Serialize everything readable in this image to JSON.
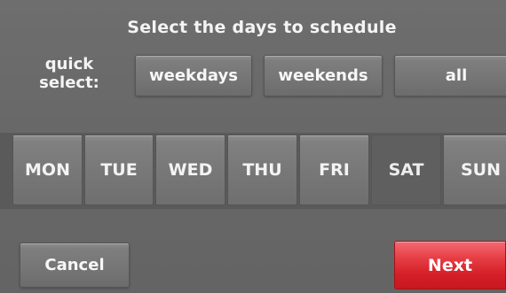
{
  "header": {
    "title": "Select the days to schedule"
  },
  "quick_select": {
    "label_line1": "quick",
    "label_line2": "select:",
    "buttons": [
      {
        "label": "weekdays"
      },
      {
        "label": "weekends"
      },
      {
        "label": "all"
      }
    ]
  },
  "days": [
    {
      "label": "MON",
      "selected": true
    },
    {
      "label": "TUE",
      "selected": true
    },
    {
      "label": "WED",
      "selected": true
    },
    {
      "label": "THU",
      "selected": true
    },
    {
      "label": "FRI",
      "selected": true
    },
    {
      "label": "SAT",
      "selected": false
    },
    {
      "label": "SUN",
      "selected": true
    }
  ],
  "footer": {
    "cancel_label": "Cancel",
    "next_label": "Next"
  },
  "colors": {
    "background": "#666666",
    "button_gray": "#777777",
    "next_red": "#d51f27",
    "text": "#ffffff"
  }
}
